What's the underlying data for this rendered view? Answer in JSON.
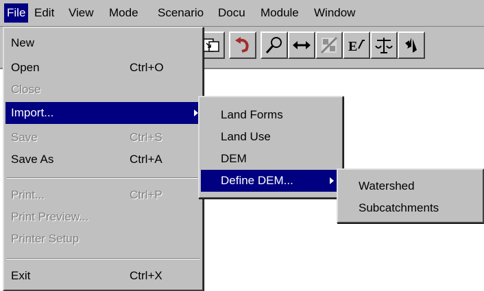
{
  "menubar": {
    "items": [
      "File",
      "Edit",
      "View",
      "Mode",
      "Scenario",
      "Docu",
      "Module",
      "Window"
    ]
  },
  "file_menu": {
    "items": [
      {
        "label": "New",
        "shortcut": ""
      },
      {
        "label": "Open",
        "shortcut": "Ctrl+O"
      },
      {
        "label": "Close",
        "shortcut": ""
      },
      {
        "label": "Import...",
        "shortcut": ""
      },
      {
        "label": "Save",
        "shortcut": "Ctrl+S"
      },
      {
        "label": "Save As",
        "shortcut": "Ctrl+A"
      },
      {
        "label": "Print...",
        "shortcut": "Ctrl+P"
      },
      {
        "label": "Print Preview...",
        "shortcut": ""
      },
      {
        "label": "Printer Setup",
        "shortcut": ""
      },
      {
        "label": "Exit",
        "shortcut": "Ctrl+X"
      }
    ]
  },
  "import_menu": {
    "items": [
      "Land Forms",
      "Land Use",
      "DEM",
      "Define DEM..."
    ]
  },
  "define_dem_menu": {
    "items": [
      "Watershed",
      "Subcatchments"
    ]
  },
  "toolbar": {
    "icons": [
      "export-icon",
      "undo-icon",
      "search-icon",
      "pan-icon",
      "split-icon",
      "formula-icon",
      "balance-icon",
      "compass-icon"
    ]
  },
  "colors": {
    "highlight": "#000080",
    "menu_face": "#c0c0c0",
    "disabled_text": "#808080"
  }
}
